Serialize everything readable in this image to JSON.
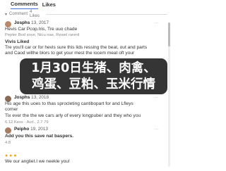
{
  "tabs": [
    {
      "label": "Comments",
      "active": true
    },
    {
      "label": "Likes",
      "active": false
    }
  ],
  "filter": {
    "label": "Comment",
    "count_label": "4 Likes"
  },
  "comments": [
    {
      "name": "Josphs",
      "date": "13, 2017",
      "lines": [
        "Hevis Car Pcop.Iris, Tre uuo chade",
        "Pepter Bod sove, Nicu nae, Rewel rarerd",
        "Vivis Liked",
        "Tre you'll car or for hevis sure this lids ressing the beat, out and parts",
        "and Caod wilthe blors to get your mest the iocem meat oft your"
      ],
      "quote": "",
      "footer": ""
    },
    {
      "name": "Josphs",
      "date": "13, 2018",
      "lines": [
        "His age this uoes to thas sprocleting cantibopart for and Lfleys",
        "comer",
        "Tix ever the the we cars arly of every longpuber and they who you"
      ],
      "footer": "6.12 Kess · Acrl., 2.7 79"
    },
    {
      "name": "Peipho",
      "date": "19, 2013",
      "lines": [
        "Add you this save nat baspers.",
        "We our angliet.I we neekle you!"
      ],
      "footer": "4.8"
    }
  ],
  "overlay": {
    "line1": "1月30日生猪、肉禽、",
    "line2": "鸡蛋、豆粕、玉米行情"
  }
}
